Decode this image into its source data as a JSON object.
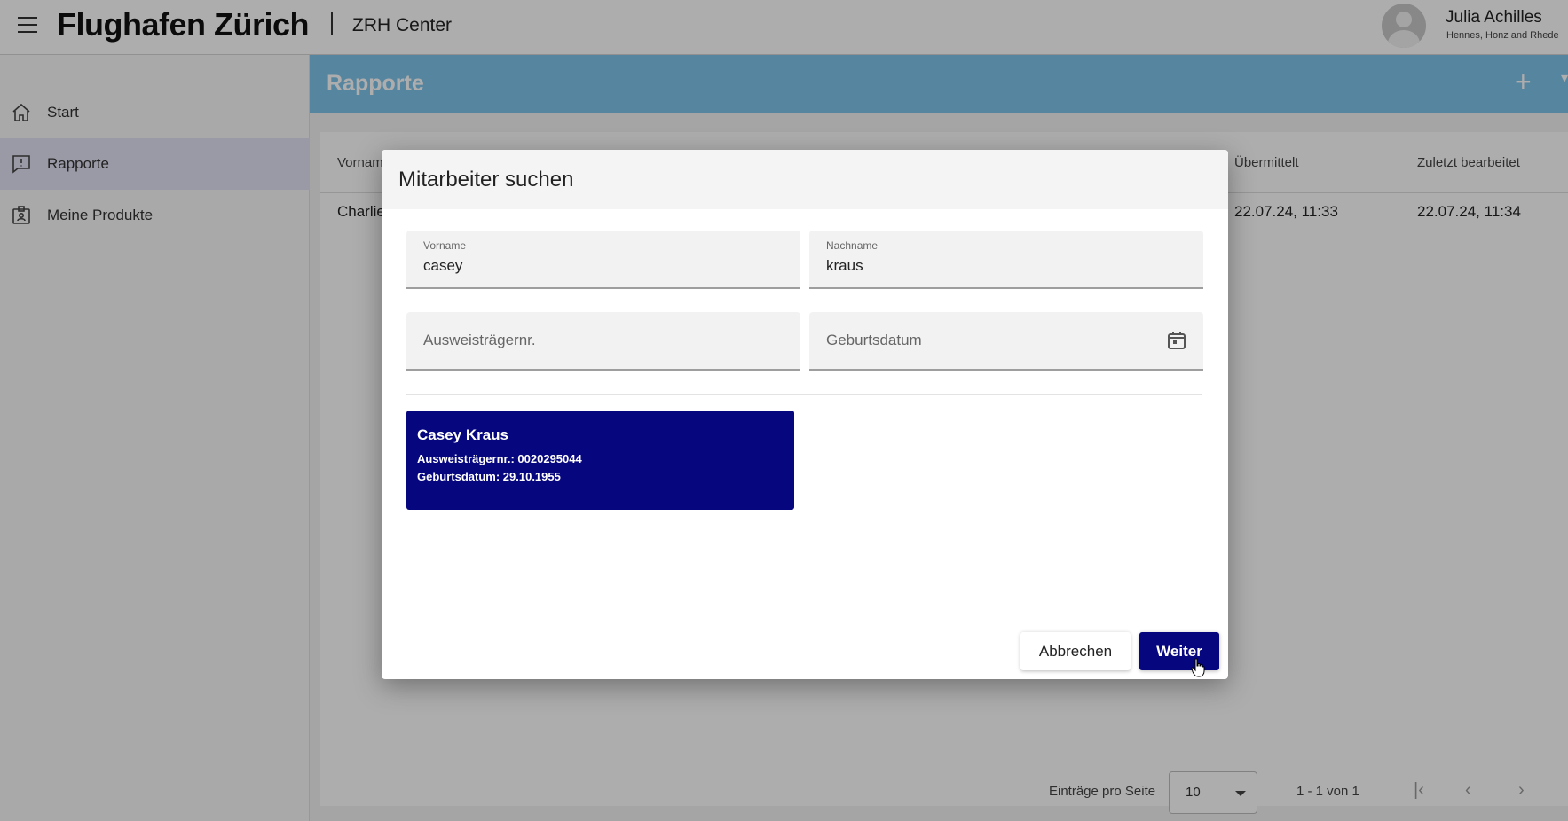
{
  "header": {
    "brand": "Flughafen Zürich",
    "subtitle": "ZRH Center",
    "user_name": "Julia Achilles",
    "user_org": "Hennes, Honz and Rhede"
  },
  "sidebar": {
    "items": [
      {
        "label": "Start",
        "icon": "home-icon",
        "active": false
      },
      {
        "label": "Rapporte",
        "icon": "report-icon",
        "active": true
      },
      {
        "label": "Meine Produkte",
        "icon": "badge-icon",
        "active": false
      }
    ]
  },
  "main": {
    "title": "Rapporte",
    "add_icon": "plus-icon",
    "table": {
      "headers": {
        "first": "Vornam",
        "submitted": "Übermittelt",
        "edited": "Zuletzt bearbeitet"
      },
      "row": {
        "first": "Charlie",
        "submitted": "22.07.24, 11:33",
        "edited": "22.07.24, 11:34"
      }
    },
    "pagination": {
      "label": "Einträge pro Seite",
      "per_page": "10",
      "range": "1 - 1 von 1"
    }
  },
  "dialog": {
    "title": "Mitarbeiter suchen",
    "firstname": {
      "label": "Vorname",
      "value": "casey"
    },
    "lastname": {
      "label": "Nachname",
      "value": "kraus"
    },
    "badge_no": {
      "placeholder": "Ausweisträgernr."
    },
    "birthdate": {
      "placeholder": "Geburtsdatum"
    },
    "result": {
      "name": "Casey Kraus",
      "badge": "Ausweisträgernr.: 0020295044",
      "birth": "Geburtsdatum: 29.10.1955"
    },
    "cancel_label": "Abbrechen",
    "next_label": "Weiter"
  },
  "colors": {
    "accent": "#06067e",
    "header_bar": "#7fc4ec",
    "active_nav": "#e4e4f6"
  }
}
